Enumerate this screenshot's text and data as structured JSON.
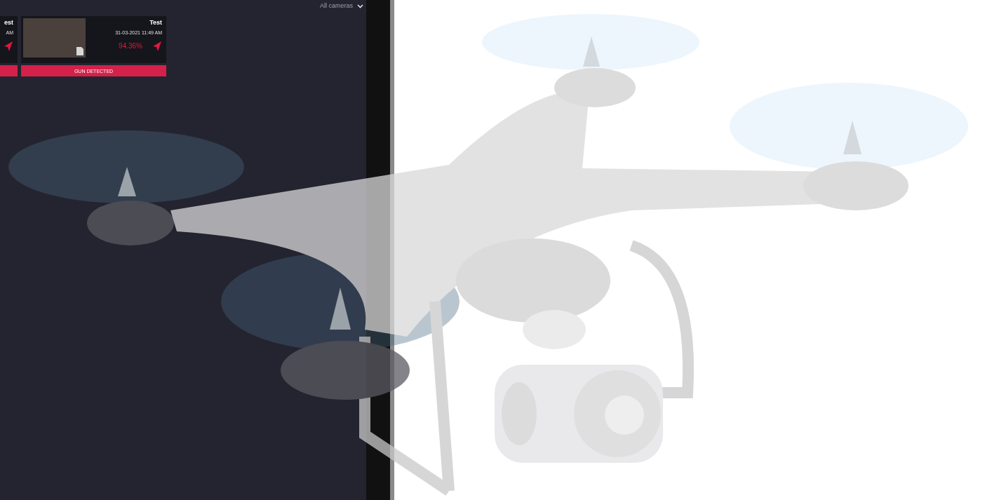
{
  "filter": {
    "label": "All cameras"
  },
  "cards": [
    {
      "title": "est",
      "time": "AM"
    },
    {
      "title": "Test",
      "time": "31-03-2021 11:49 AM",
      "confidence": "94.36%",
      "alert": "GUN DETECTED"
    }
  ]
}
